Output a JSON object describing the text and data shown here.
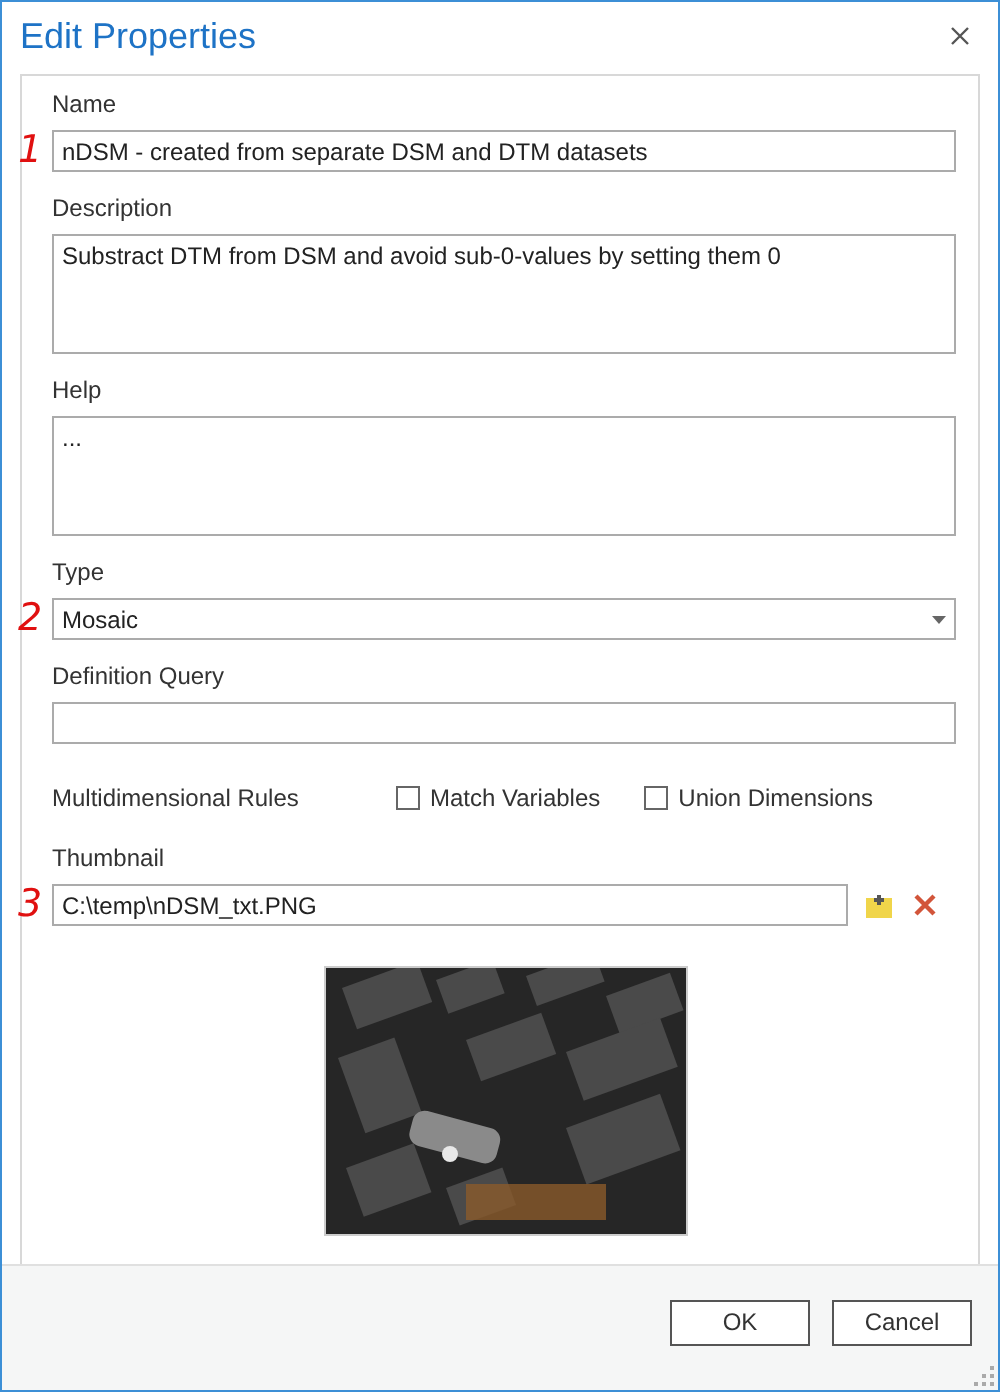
{
  "window": {
    "title": "Edit Properties"
  },
  "fields": [
    {
      "kind": "text",
      "label": "Name",
      "value": "nDSM - created from separate DSM and DTM datasets",
      "marker": "1"
    },
    {
      "kind": "textarea",
      "label": "Description",
      "value": "Substract DTM from DSM and avoid sub-0-values by setting them 0"
    },
    {
      "kind": "textarea",
      "label": "Help",
      "value": "..."
    },
    {
      "kind": "dropdown",
      "label": "Type",
      "value": "Mosaic",
      "marker": "2"
    },
    {
      "kind": "text",
      "label": "Definition Query"
    }
  ],
  "multidimensional": {
    "label": "Multidimensional Rules",
    "options": [
      {
        "label": "Match Variables",
        "checked": false
      },
      {
        "label": "Union Dimensions",
        "checked": false
      }
    ]
  },
  "thumbnail": {
    "label": "Thumbnail",
    "value": "C:\\temp\\nDSM_txt.PNG",
    "marker": "3"
  },
  "buttons": [
    {
      "label": "OK"
    },
    {
      "label": "Cancel"
    }
  ]
}
